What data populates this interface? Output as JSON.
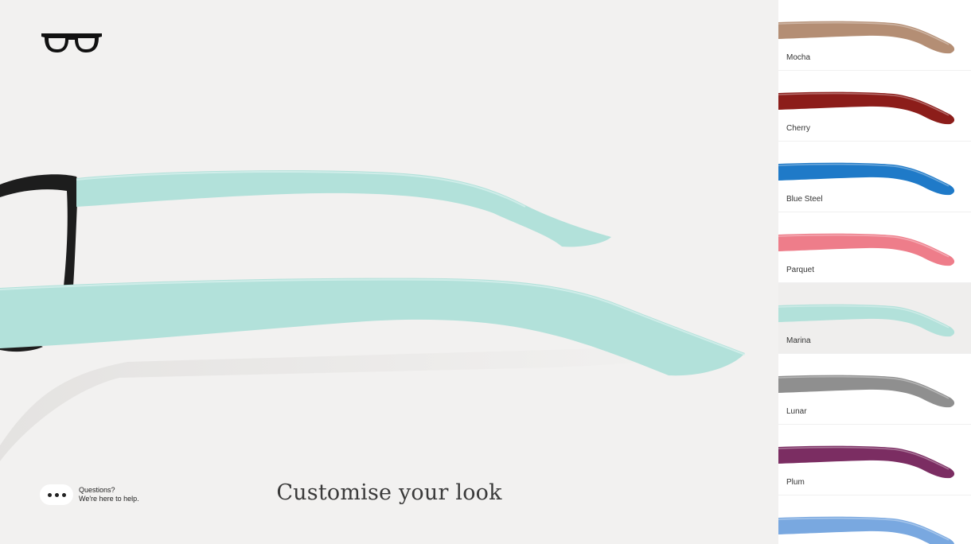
{
  "brand": {
    "logo_icon": "glasses-icon"
  },
  "main": {
    "headline": "Customise your look",
    "selected_color": "Marina",
    "selected_hex": "#b2e1da"
  },
  "help": {
    "line1": "Questions?",
    "line2": "We're here to help."
  },
  "colors": [
    {
      "name": "Mocha",
      "hex": "#b48e74"
    },
    {
      "name": "Cherry",
      "hex": "#8c1d1a"
    },
    {
      "name": "Blue Steel",
      "hex": "#1f7ac8"
    },
    {
      "name": "Parquet",
      "hex": "#ee7d8a"
    },
    {
      "name": "Marina",
      "hex": "#b2e1da"
    },
    {
      "name": "Lunar",
      "hex": "#8f8f8f"
    },
    {
      "name": "Plum",
      "hex": "#7b2d62"
    },
    {
      "name": "",
      "hex": "#79a8e0"
    }
  ]
}
